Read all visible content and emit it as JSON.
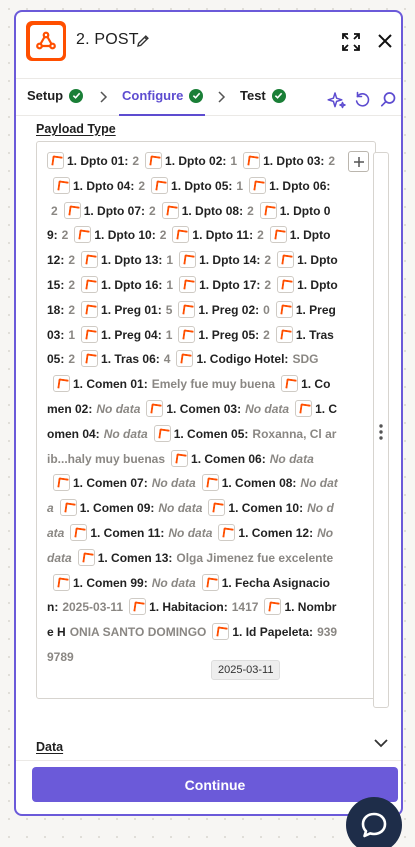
{
  "header": {
    "title": "2. POST"
  },
  "steps": [
    {
      "label": "Setup"
    },
    {
      "label": "Configure"
    },
    {
      "label": "Test"
    }
  ],
  "payload": {
    "label": "Payload Type",
    "items": [
      {
        "key": "1. Dpto 01:",
        "value": "2"
      },
      {
        "key": "1. Dpto 02:",
        "value": "1"
      },
      {
        "key": "1. Dpto 03:",
        "value": "2"
      },
      {
        "key": "1. Dpto 04:",
        "value": "2"
      },
      {
        "key": "1. Dpto 05:",
        "value": "1"
      },
      {
        "key": "1. Dpto 06:",
        "value": "2"
      },
      {
        "key": "1. Dpto 07:",
        "value": "2"
      },
      {
        "key": "1. Dpto 08:",
        "value": "2"
      },
      {
        "key": "1. Dpto 09:",
        "value": "2"
      },
      {
        "key": "1. Dpto 10:",
        "value": "2"
      },
      {
        "key": "1. Dpto 11:",
        "value": "2"
      },
      {
        "key": "1. Dpto 12:",
        "value": "2"
      },
      {
        "key": "1. Dpto 13:",
        "value": "1"
      },
      {
        "key": "1. Dpto 14:",
        "value": "2"
      },
      {
        "key": "1. Dpto 15:",
        "value": "2"
      },
      {
        "key": "1. Dpto 16:",
        "value": "1"
      },
      {
        "key": "1. Dpto 17:",
        "value": "2"
      },
      {
        "key": "1. Dpto 18:",
        "value": "2"
      },
      {
        "key": "1. Preg 01:",
        "value": "5"
      },
      {
        "key": "1. Preg 02:",
        "value": "0"
      },
      {
        "key": "1. Preg 03:",
        "value": "1"
      },
      {
        "key": "1. Preg 04:",
        "value": "1"
      },
      {
        "key": "1. Preg 05:",
        "value": "2"
      },
      {
        "key": "1. Tras 05:",
        "value": "2"
      },
      {
        "key": "1. Tras 06:",
        "value": "4"
      },
      {
        "key": "1. Codigo Hotel:",
        "value": "SDG"
      },
      {
        "key": "1. Comen 01:",
        "value": "Emely fue muy buena"
      },
      {
        "key": "1. Comen 02:",
        "value": "No data",
        "na": true
      },
      {
        "key": "1. Comen 03:",
        "value": "No data",
        "na": true
      },
      {
        "key": "1. Comen 04:",
        "value": "No data",
        "na": true
      },
      {
        "key": "1. Comen 05:",
        "value": "Roxanna, Cl arib...haly muy buenas"
      },
      {
        "key": "1. Comen 06:",
        "value": "No data",
        "na": true
      },
      {
        "key": "1. Comen 07:",
        "value": "No data",
        "na": true
      },
      {
        "key": "1. Comen 08:",
        "value": "No data",
        "na": true
      },
      {
        "key": "1. Comen 09:",
        "value": "No data",
        "na": true
      },
      {
        "key": "1. Comen 10:",
        "value": "No data",
        "na": true
      },
      {
        "key": "1. Comen 11:",
        "value": "No data",
        "na": true
      },
      {
        "key": "1. Comen 12:",
        "value": "No data",
        "na": true
      },
      {
        "key": "1. Comen 13:",
        "value": "Olga Jimenez fue excelente"
      },
      {
        "key": "1. Comen 99:",
        "value": "No data",
        "na": true
      },
      {
        "key": "1. Fecha Asignacion:",
        "value": "2025-03-11"
      },
      {
        "key": "1. Habitacion:",
        "value": "1417"
      },
      {
        "key": "1. Nombre H",
        "value": "ONIA SANTO DOMINGO"
      },
      {
        "key": "1. Id Papeleta:",
        "value": "9399789"
      }
    ],
    "tooltip": "2025-03-11"
  },
  "data_section": {
    "label": "Data"
  },
  "footer": {
    "continue_label": "Continue"
  },
  "colors": {
    "accent": "#6b5ad9",
    "brand": "#ff4f00",
    "success": "#1a7f37",
    "chat": "#1e2d49"
  },
  "icons": [
    "webhook-icon",
    "edit-icon",
    "expand-icon",
    "close-icon",
    "check-icon",
    "chevron-right-icon",
    "ai-sparkle-icon",
    "undo-icon",
    "search-icon",
    "plus-icon",
    "kebab-icon",
    "chevron-down-icon",
    "chat-icon"
  ]
}
